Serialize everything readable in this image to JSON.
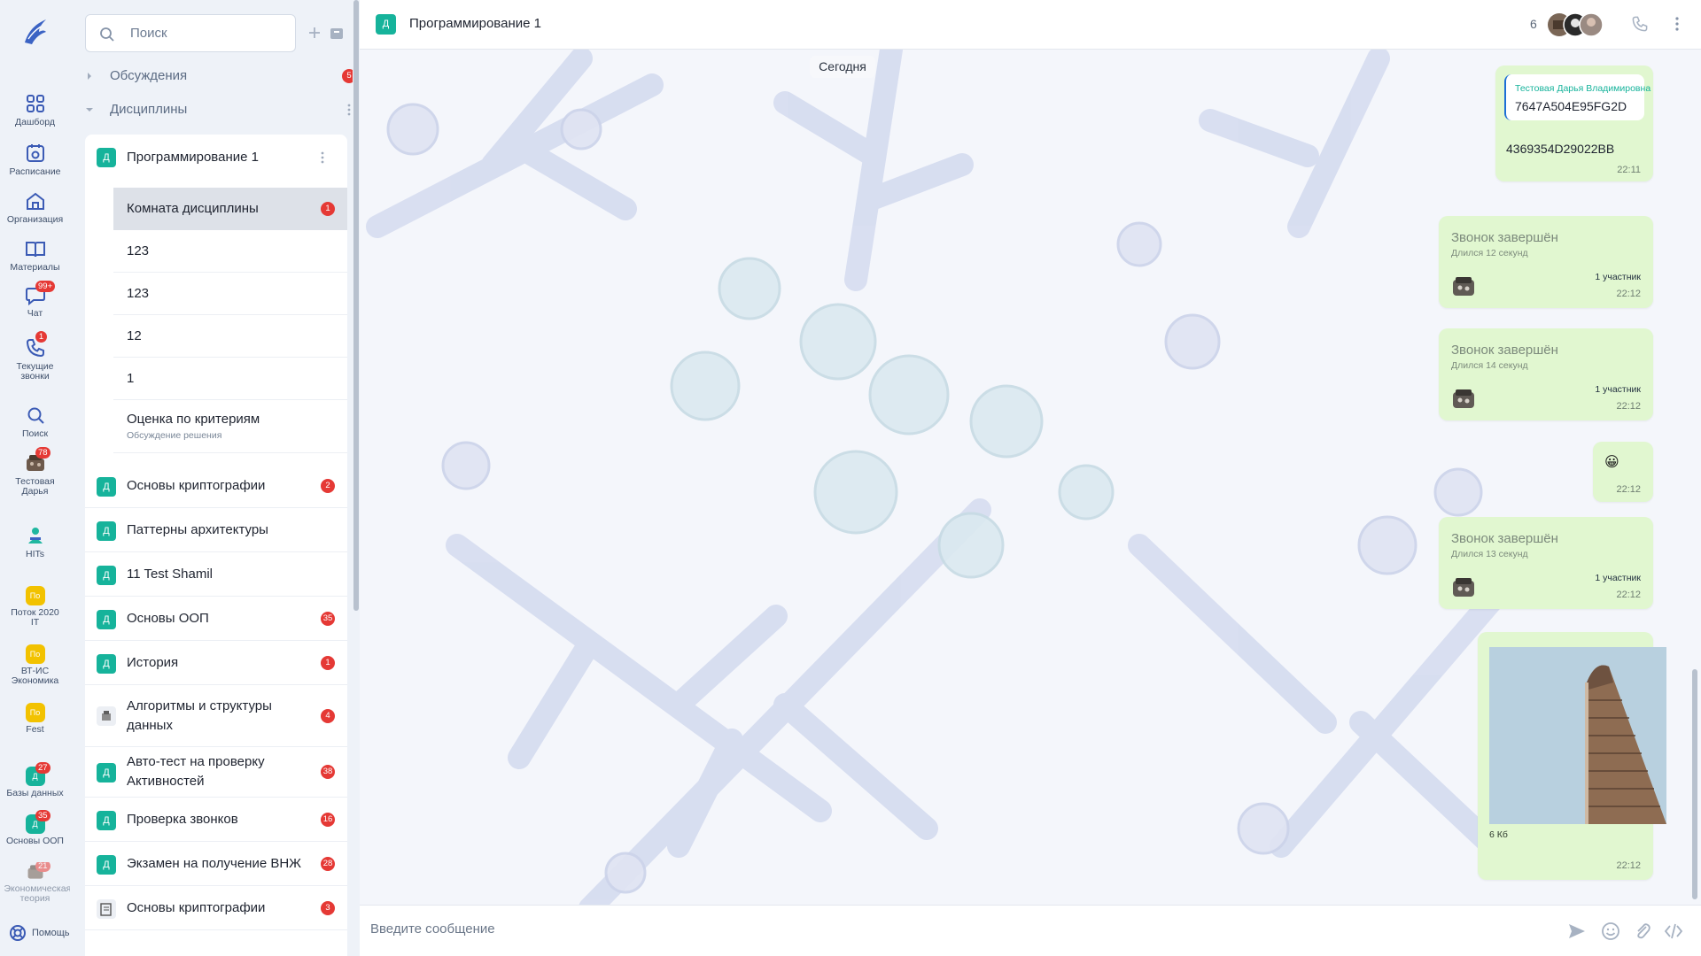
{
  "rail": {
    "items": [
      {
        "label": "Дашборд",
        "icon": "dashboard-icon"
      },
      {
        "label": "Расписание",
        "icon": "calendar-icon"
      },
      {
        "label": "Организация",
        "icon": "organization-icon"
      },
      {
        "label": "Материалы",
        "icon": "book-icon"
      },
      {
        "label": "Чат",
        "icon": "chat-icon",
        "badge": "99+"
      },
      {
        "label": "Текущие звонки",
        "icon": "phone-icon",
        "badge": "1"
      },
      {
        "label": "Поиск",
        "icon": "search-icon"
      },
      {
        "label": "Тестовая Дарья",
        "icon": "user-avatar",
        "badge": "78"
      },
      {
        "label": "HITs",
        "icon": "hits-icon"
      },
      {
        "label": "Поток 2020 IT",
        "abbr": "По"
      },
      {
        "label": "ВТ-ИС Экономика",
        "abbr": "По"
      },
      {
        "label": "Fest",
        "abbr": "По"
      },
      {
        "label": "Базы данных",
        "abbr": "Д",
        "badge": "27"
      },
      {
        "label": "Основы ООП",
        "abbr": "Д",
        "badge": "35"
      },
      {
        "label": "Экономическая теория",
        "badge": "21"
      }
    ],
    "help": "Помощь"
  },
  "sidebar": {
    "search_placeholder": "Поиск",
    "sections": [
      {
        "label": "Обсуждения",
        "badge": "5"
      },
      {
        "label": "Дисциплины"
      }
    ],
    "active_discipline": {
      "abbr": "Д",
      "name": "Программирование 1"
    },
    "rooms": [
      {
        "name": "Комната дисциплины",
        "badge": "1",
        "active": true
      },
      {
        "name": "123"
      },
      {
        "name": "123"
      },
      {
        "name": "12"
      },
      {
        "name": "1"
      },
      {
        "name": "Оценка по критериям",
        "sub": "Обсуждение решения"
      }
    ],
    "disciplines": [
      {
        "abbr": "Д",
        "name": "Основы криптографии",
        "badge": "2"
      },
      {
        "abbr": "Д",
        "name": "Паттерны архитектуры"
      },
      {
        "abbr": "Д",
        "name": "11 Test Shamil"
      },
      {
        "abbr": "Д",
        "name": "Основы ООП",
        "badge": "35"
      },
      {
        "abbr": "Д",
        "name": "История",
        "badge": "1"
      },
      {
        "abbr": "",
        "name": "Алгоритмы и структуры данных",
        "badge": "4"
      },
      {
        "abbr": "Д",
        "name": "Авто-тест на проверку Активностей",
        "badge": "38"
      },
      {
        "abbr": "Д",
        "name": "Проверка звонков",
        "badge": "16"
      },
      {
        "abbr": "Д",
        "name": "Экзамен на получение ВНЖ",
        "badge": "28"
      },
      {
        "abbr": "",
        "name": "Основы криптографии",
        "badge": "3"
      }
    ]
  },
  "header": {
    "abbr": "Д",
    "title": "Программирование 1",
    "members_count": "6"
  },
  "chat": {
    "date_label": "Сегодня",
    "messages": [
      {
        "type": "forward",
        "quote_author": "Тестовая Дарья Владимировна",
        "quote_text": "7647A504E95FG2D",
        "text": "4369354D29022BB",
        "time": "22:11"
      },
      {
        "type": "call",
        "title": "Звонок завершён",
        "duration": "Длился 12 секунд",
        "participants": "1 участник",
        "time": "22:12"
      },
      {
        "type": "call",
        "title": "Звонок завершён",
        "duration": "Длился 14 секунд",
        "participants": "1 участник",
        "time": "22:12"
      },
      {
        "type": "emoji",
        "text": "😀",
        "time": "22:12"
      },
      {
        "type": "call",
        "title": "Звонок завершён",
        "duration": "Длился 13 секунд",
        "participants": "1 участник",
        "time": "22:12"
      },
      {
        "type": "image",
        "size": "6 Кб",
        "time": "22:12"
      }
    ]
  },
  "composer": {
    "placeholder": "Введите сообщение"
  },
  "colors": {
    "accent": "#16b39b",
    "badge": "#e53935",
    "bubble": "#e1f7d0",
    "rail_bg": "#eef2f8"
  }
}
